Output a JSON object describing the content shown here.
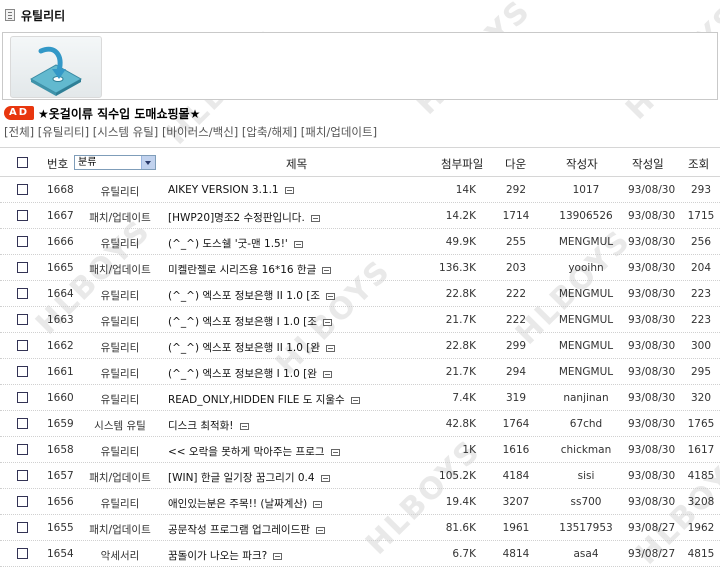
{
  "page": {
    "title": "유틸리티",
    "watermark": "HLBOYS",
    "ad_badge": "AD",
    "ad_text": "★옷걸이류 직수입 도매쇼핑몰★",
    "categories": [
      "[전체]",
      "[유틸리티]",
      "[시스템 유틸]",
      "[바이러스/백신]",
      "[압축/해제]",
      "[패치/업데이트]"
    ]
  },
  "table": {
    "header": {
      "number": "번호",
      "category_select": "분류",
      "title": "제목",
      "size": "첨부파일",
      "downloads": "다운",
      "author": "작성자",
      "date": "작성일",
      "views": "조회"
    },
    "rows": [
      {
        "num": "1668",
        "cat": "유틸리티",
        "title": "AIKEY VERSION 3.1.1",
        "size": "14K",
        "down": "292",
        "author": "1017",
        "date": "93/08/30",
        "views": "293"
      },
      {
        "num": "1667",
        "cat": "패치/업데이트",
        "title": "[HWP20]명조2 수정판입니다.",
        "size": "14.2K",
        "down": "1714",
        "author": "13906526",
        "date": "93/08/30",
        "views": "1715"
      },
      {
        "num": "1666",
        "cat": "유틸리티",
        "title": "(^_^) 도스쉘 '굿-맨 1.5!'",
        "size": "49.9K",
        "down": "255",
        "author": "MENGMUL",
        "date": "93/08/30",
        "views": "256"
      },
      {
        "num": "1665",
        "cat": "패치/업데이트",
        "title": "미켈란젤로 시리즈용 16*16 한글",
        "size": "136.3K",
        "down": "203",
        "author": "yooihn",
        "date": "93/08/30",
        "views": "204"
      },
      {
        "num": "1664",
        "cat": "유틸리티",
        "title": "(^_^) 엑스포 정보은행 II 1.0 [조",
        "size": "22.8K",
        "down": "222",
        "author": "MENGMUL",
        "date": "93/08/30",
        "views": "223"
      },
      {
        "num": "1663",
        "cat": "유틸리티",
        "title": "(^_^) 엑스포 정보은행 I 1.0 [조",
        "size": "21.7K",
        "down": "222",
        "author": "MENGMUL",
        "date": "93/08/30",
        "views": "223"
      },
      {
        "num": "1662",
        "cat": "유틸리티",
        "title": "(^_^) 엑스포 정보은행 II 1.0 [완",
        "size": "22.8K",
        "down": "299",
        "author": "MENGMUL",
        "date": "93/08/30",
        "views": "300"
      },
      {
        "num": "1661",
        "cat": "유틸리티",
        "title": "(^_^) 엑스포 정보은행 I 1.0 [완",
        "size": "21.7K",
        "down": "294",
        "author": "MENGMUL",
        "date": "93/08/30",
        "views": "295"
      },
      {
        "num": "1660",
        "cat": "유틸리티",
        "title": "READ_ONLY,HIDDEN FILE 도 지울수",
        "size": "7.4K",
        "down": "319",
        "author": "nanjinan",
        "date": "93/08/30",
        "views": "320"
      },
      {
        "num": "1659",
        "cat": "시스템 유틸",
        "title": "디스크 최적화!",
        "size": "42.8K",
        "down": "1764",
        "author": "67chd",
        "date": "93/08/30",
        "views": "1765"
      },
      {
        "num": "1658",
        "cat": "유틸리티",
        "title": "<< 오락을 못하게 막아주는 프로그",
        "size": "1K",
        "down": "1616",
        "author": "chickman",
        "date": "93/08/30",
        "views": "1617"
      },
      {
        "num": "1657",
        "cat": "패치/업데이트",
        "title": "[WIN] 한글 일기장 꿈그리기 0.4",
        "size": "105.2K",
        "down": "4184",
        "author": "sisi",
        "date": "93/08/30",
        "views": "4185"
      },
      {
        "num": "1656",
        "cat": "유틸리티",
        "title": "애인있는분은 주목!! (날짜계산)",
        "size": "19.4K",
        "down": "3207",
        "author": "ss700",
        "date": "93/08/30",
        "views": "3208"
      },
      {
        "num": "1655",
        "cat": "패치/업데이트",
        "title": "공문작성 프로그램 업그레이드판",
        "size": "81.6K",
        "down": "1961",
        "author": "13517953",
        "date": "93/08/27",
        "views": "1962"
      },
      {
        "num": "1654",
        "cat": "악세서리",
        "title": "꿈돌이가 나오는 파크?",
        "size": "6.7K",
        "down": "4814",
        "author": "asa4",
        "date": "93/08/27",
        "views": "4815"
      }
    ]
  }
}
